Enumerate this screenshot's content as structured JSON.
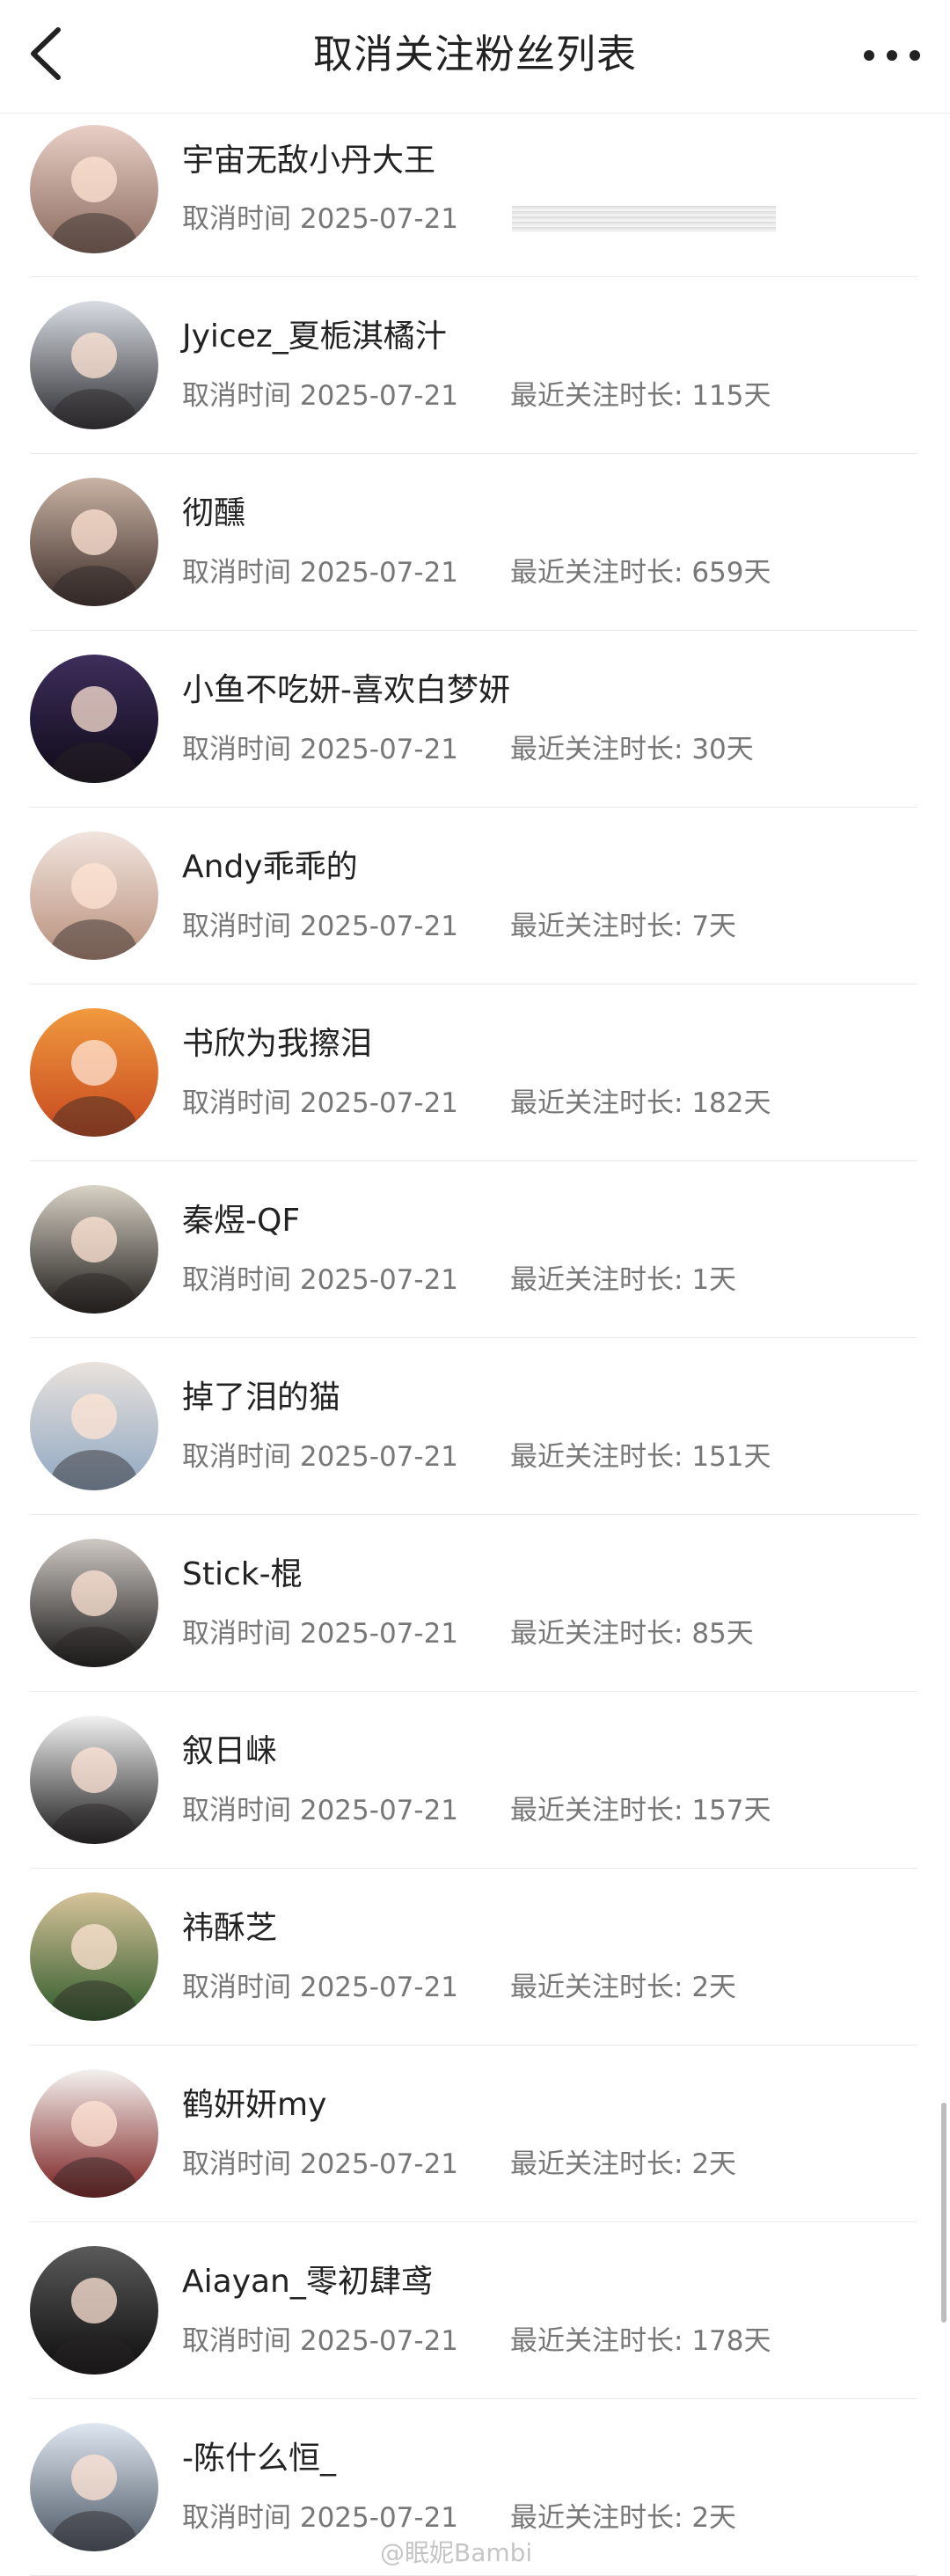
{
  "header": {
    "title": "取消关注粉丝列表",
    "back_icon": "chevron-left-icon",
    "more_icon": "more-dots-icon"
  },
  "colors": {
    "text_primary": "#222222",
    "text_secondary": "#777777",
    "divider": "#e9e9e9",
    "background": "#ffffff"
  },
  "meta_label": "取消时间",
  "duration_label": "最近关注时长: ",
  "rows": [
    {
      "name": "宇宙无敌小丹大王",
      "date": "2025-07-21",
      "duration": "",
      "avatar_colors": [
        "#e8cfc6",
        "#8a6a5e"
      ]
    },
    {
      "name": "Jyicez_夏栀淇橘汁",
      "date": "2025-07-21",
      "duration": "115天",
      "avatar_colors": [
        "#d9dde3",
        "#2b2b2f"
      ]
    },
    {
      "name": "彻醺",
      "date": "2025-07-21",
      "duration": "659天",
      "avatar_colors": [
        "#c9b3a4",
        "#3b2c28"
      ]
    },
    {
      "name": "小鱼不吃妍-喜欢白梦妍",
      "date": "2025-07-21",
      "duration": "30天",
      "avatar_colors": [
        "#3e2e5c",
        "#0e0a17"
      ]
    },
    {
      "name": "Andy乖乖的",
      "date": "2025-07-21",
      "duration": "7天",
      "avatar_colors": [
        "#f1e5de",
        "#b88f7b"
      ]
    },
    {
      "name": "书欣为我擦泪",
      "date": "2025-07-21",
      "duration": "182天",
      "avatar_colors": [
        "#f09a3e",
        "#c7481f"
      ]
    },
    {
      "name": "秦煜-QF",
      "date": "2025-07-21",
      "duration": "1天",
      "avatar_colors": [
        "#d9d2c6",
        "#1c1a18"
      ]
    },
    {
      "name": "掉了泪的猫",
      "date": "2025-07-21",
      "duration": "151天",
      "avatar_colors": [
        "#e9e2dc",
        "#8fa7c2"
      ]
    },
    {
      "name": "Stick-棍",
      "date": "2025-07-21",
      "duration": "85天",
      "avatar_colors": [
        "#cfc9c4",
        "#141414"
      ]
    },
    {
      "name": "叙日崃",
      "date": "2025-07-21",
      "duration": "157天",
      "avatar_colors": [
        "#f2f2f2",
        "#1a1a1a"
      ]
    },
    {
      "name": "祎酥芝",
      "date": "2025-07-21",
      "duration": "2天",
      "avatar_colors": [
        "#d7c39a",
        "#2e5a2a"
      ]
    },
    {
      "name": "鹤妍妍my",
      "date": "2025-07-21",
      "duration": "2天",
      "avatar_colors": [
        "#f4f1ee",
        "#7a1e1e"
      ]
    },
    {
      "name": "Aiayan_零初肆鸢",
      "date": "2025-07-21",
      "duration": "178天",
      "avatar_colors": [
        "#5a5a5a",
        "#0c0c0c"
      ]
    },
    {
      "name": "-陈什么恒_",
      "date": "2025-07-21",
      "duration": "2天",
      "avatar_colors": [
        "#dfe8f1",
        "#4b5563"
      ]
    }
  ],
  "watermark": "@眠妮Bambi"
}
